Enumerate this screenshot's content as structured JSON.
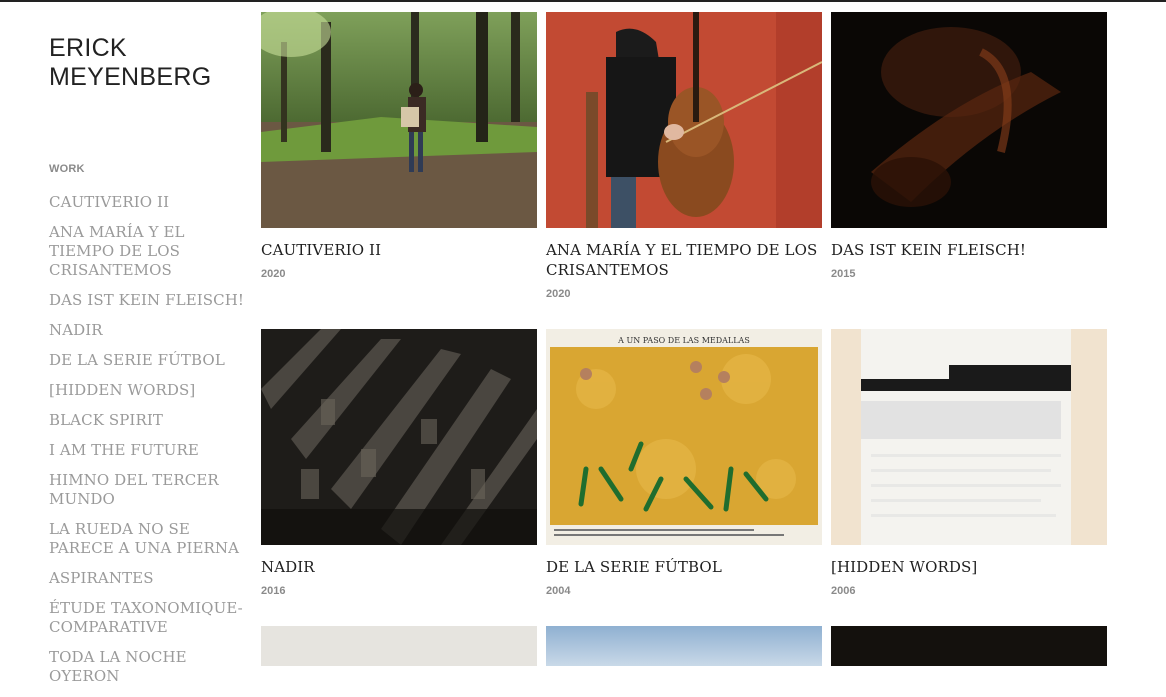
{
  "site": {
    "title": "ERICK MEYENBERG"
  },
  "sidebar": {
    "section_label": "WORK",
    "items": [
      {
        "label": "CAUTIVERIO II"
      },
      {
        "label": "ANA MARÍA Y EL TIEMPO DE LOS CRISANTEMOS"
      },
      {
        "label": "DAS IST KEIN FLEISCH!"
      },
      {
        "label": "NADIR"
      },
      {
        "label": "DE LA SERIE FÚTBOL"
      },
      {
        "label": "[HIDDEN WORDS]"
      },
      {
        "label": "BLACK SPIRIT"
      },
      {
        "label": "I AM THE FUTURE"
      },
      {
        "label": "HIMNO DEL TERCER MUNDO"
      },
      {
        "label": "LA RUEDA NO SE PARECE A UNA PIERNA"
      },
      {
        "label": "ASPIRANTES"
      },
      {
        "label": "ÉTUDE TAXONOMIQUE-COMPARATIVE"
      },
      {
        "label": "TODA LA NOCHE OYERON"
      }
    ]
  },
  "works": [
    {
      "title": "CAUTIVERIO II",
      "year": "2020",
      "image": "forest-accordion-player"
    },
    {
      "title": "ANA MARÍA Y EL TIEMPO DE LOS CRISANTEMOS",
      "year": "2020",
      "image": "cellist-red-wall"
    },
    {
      "title": "DAS IST KEIN FLEISCH!",
      "year": "2015",
      "image": "dark-skin-closeup"
    },
    {
      "title": "NADIR",
      "year": "2016",
      "image": "dark-crystal-columns"
    },
    {
      "title": "DE LA SERIE FÚTBOL",
      "year": "2004",
      "image": "footballers-gold-collage",
      "caption": "A UN PASO DE LAS MEDALLAS"
    },
    {
      "title": "[HIDDEN WORDS]",
      "year": "2006",
      "image": "redacted-text-page"
    }
  ]
}
